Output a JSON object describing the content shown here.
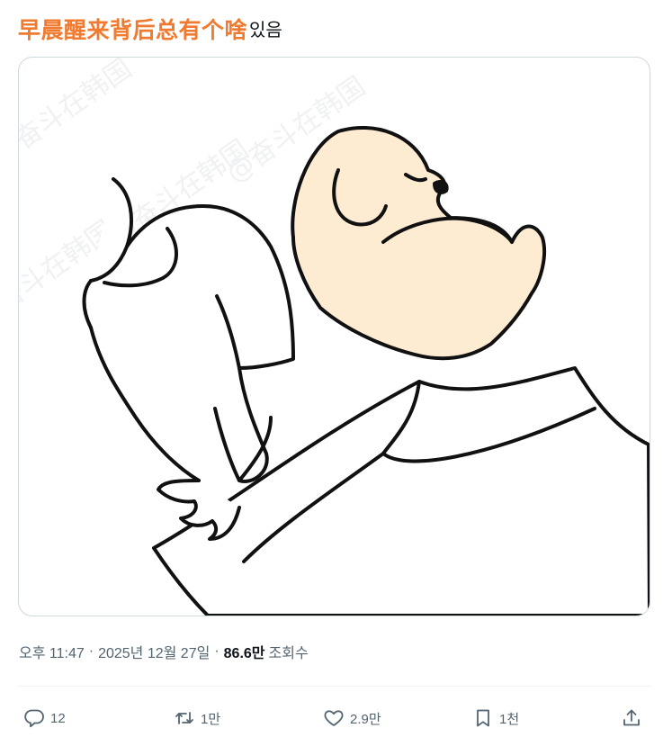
{
  "post": {
    "overlay_text": "早晨醒来背后总有个啥",
    "body_text": "있음"
  },
  "meta": {
    "time": "오후 11:47",
    "separator": "·",
    "date": "2025년 12월 27일",
    "views_count": "86.6만",
    "views_label": "조회수"
  },
  "actions": {
    "reply": {
      "icon": "reply-icon",
      "count": "12"
    },
    "repost": {
      "icon": "repost-icon",
      "count": "1만"
    },
    "like": {
      "icon": "heart-icon",
      "count": "2.9만"
    },
    "bookmark": {
      "icon": "bookmark-icon",
      "count": "1천"
    },
    "share": {
      "icon": "share-icon"
    }
  },
  "colors": {
    "overlay_text": "#f07a2f",
    "dog_fill": "#fdebd2",
    "muted": "#536471",
    "border": "#cfd9de"
  }
}
